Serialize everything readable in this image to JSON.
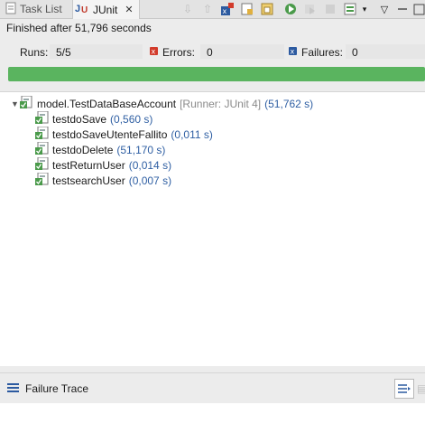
{
  "tabs": {
    "task_list": "Task List",
    "junit": "JUnit",
    "close": "✕"
  },
  "status": "Finished after 51,796 seconds",
  "counters": {
    "runs_label": "Runs:",
    "runs_value": "5/5",
    "errors_label": "Errors:",
    "errors_value": "0",
    "failures_label": "Failures:",
    "failures_value": "0"
  },
  "progress": {
    "fraction": 1.0,
    "color": "#5ab45f"
  },
  "tree": {
    "suite": {
      "name": "model.TestDataBaseAccount",
      "runner": "[Runner: JUnit 4]",
      "time": "(51,762 s)"
    },
    "tests": [
      {
        "name": "testdoSave",
        "time": "(0,560 s)"
      },
      {
        "name": "testdoSaveUtenteFallito",
        "time": "(0,011 s)"
      },
      {
        "name": "testdoDelete",
        "time": "(51,170 s)"
      },
      {
        "name": "testReturnUser",
        "time": "(0,014 s)"
      },
      {
        "name": "testsearchUser",
        "time": "(0,007 s)"
      }
    ]
  },
  "trace": {
    "title": "Failure Trace"
  },
  "icons": {
    "tasklist": "task-list-icon",
    "junit": "junit-icon",
    "errors": "error-icon",
    "failures": "failure-icon",
    "test_ok": "test-pass-icon",
    "suite_ok": "suite-pass-icon"
  }
}
